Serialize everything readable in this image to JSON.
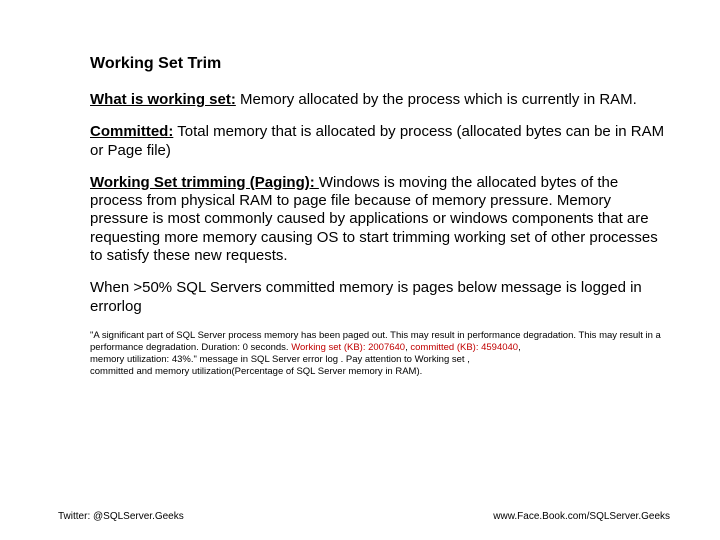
{
  "title": "Working Set Trim",
  "defs": {
    "ws_label": "What is working set:",
    "ws_text": " Memory allocated by the process which is currently in RAM.",
    "committed_label": "Committed:",
    "committed_text": " Total memory that is allocated by process (allocated bytes can be in RAM or Page file)",
    "trim_label": " Working Set trimming (Paging): ",
    "trim_text": " Windows is moving the allocated bytes of the process from physical RAM to page file because of memory pressure. Memory pressure is most commonly caused by applications or windows components that are requesting more memory causing OS to start trimming working set of other processes to satisfy these new requests."
  },
  "threshold": "When >50% SQL Servers committed memory is pages below message is logged in errorlog",
  "notice": {
    "line1": "\"A significant part of SQL Server process memory has been paged out. This may result in performance degradation. This may result in a performance degradation. Duration: 0 seconds. ",
    "ws_red": "Working set (KB): 2007640",
    "mid": ", ",
    "comm_red": "committed (KB): 4594040",
    "after_comm": ",",
    "line2_a": " memory utilization: 43%.\" message in SQL Server error log . Pay attention to Working set ,",
    "line3": " committed and memory utilization(Percentage of SQL Server memory in RAM)."
  },
  "footer": {
    "left": "Twitter: @SQLServer.Geeks",
    "right": "www.Face.Book.com/SQLServer.Geeks"
  }
}
